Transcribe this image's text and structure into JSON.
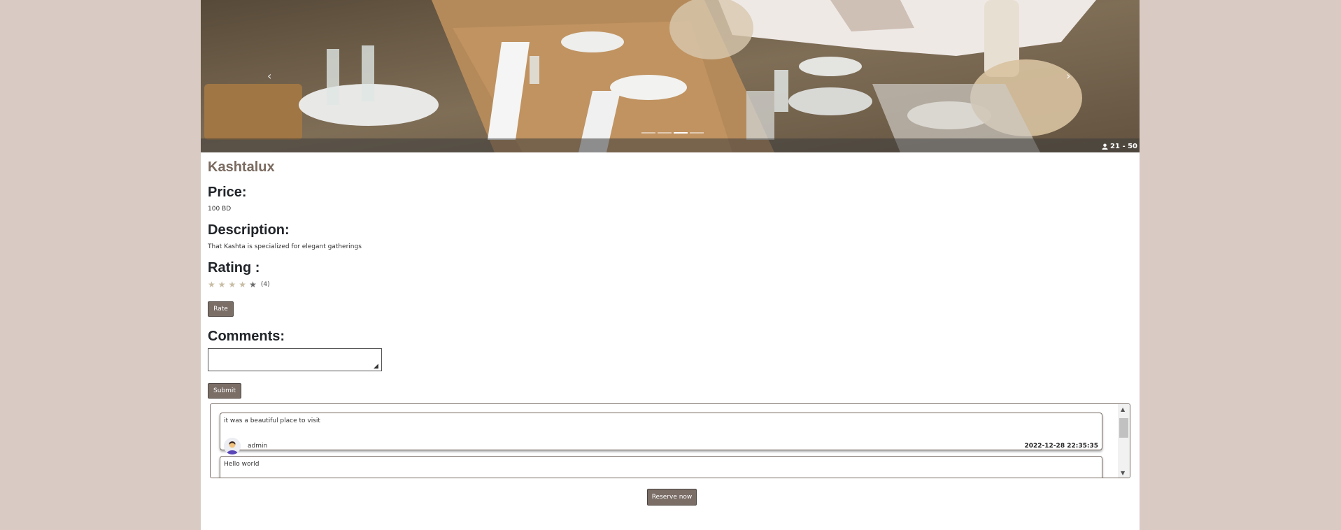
{
  "carousel": {
    "capacity": "21 - 50",
    "prev_icon": "chevron-left-icon",
    "next_icon": "chevron-right-icon",
    "slides": 4,
    "active_slide": 3
  },
  "place": {
    "name": "Kashtalux"
  },
  "price": {
    "heading": "Price:",
    "value": "100 BD"
  },
  "description": {
    "heading": "Description:",
    "value": "That Kashta is specialized for elegant gatherings"
  },
  "rating": {
    "heading": "Rating :",
    "stars_filled": 4,
    "stars_total": 5,
    "count": "(4)",
    "star_color": "#c8bca3",
    "rate_label": "Rate"
  },
  "comments": {
    "heading": "Comments:",
    "input_value": "",
    "submit_label": "Submit",
    "items": [
      {
        "text": "it was a beautiful place to visit",
        "user": "admin",
        "date": "2022-12-28 22:35:35"
      },
      {
        "text": "Hello world"
      }
    ]
  },
  "reserve_label": "Reserve now",
  "colors": {
    "page_bg": "#d9cbc3",
    "button_bg": "#7b6e67",
    "title_color": "#7a6a5f"
  }
}
